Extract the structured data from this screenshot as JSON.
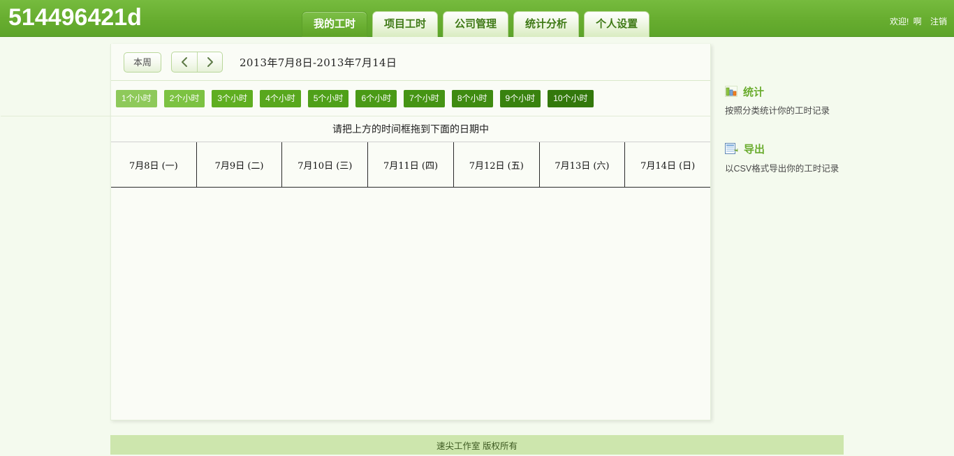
{
  "header": {
    "brand": "514496421d",
    "tabs": [
      {
        "label": "我的工时",
        "active": true
      },
      {
        "label": "项目工时",
        "active": false
      },
      {
        "label": "公司管理",
        "active": false
      },
      {
        "label": "统计分析",
        "active": false
      },
      {
        "label": "个人设置",
        "active": false
      }
    ],
    "welcome": "欢迎!",
    "user_name": "啊",
    "logout": "注销",
    "bg_color": "#67ad2f"
  },
  "toolbar": {
    "this_week_label": "本周",
    "prev_icon": "chevron-left-icon",
    "next_icon": "chevron-right-icon",
    "date_range": "2013年7月8日-2013年7月14日"
  },
  "chips": [
    {
      "label": "1个小时",
      "color": "#8ec95a"
    },
    {
      "label": "2个小时",
      "color": "#7cc242"
    },
    {
      "label": "3个小时",
      "color": "#5fae21"
    },
    {
      "label": "4个小时",
      "color": "#58a71d"
    },
    {
      "label": "5个小时",
      "color": "#4fa019"
    },
    {
      "label": "6个小时",
      "color": "#4a9a16"
    },
    {
      "label": "7个小时",
      "color": "#459414"
    },
    {
      "label": "8个小时",
      "color": "#3f8b11"
    },
    {
      "label": "9个小时",
      "color": "#39820f"
    },
    {
      "label": "10个小时",
      "color": "#33780c"
    }
  ],
  "hint": "请把上方的时间框拖到下面的日期中",
  "days": [
    "7月8日 (一)",
    "7月9日 (二)",
    "7月10日 (三)",
    "7月11日 (四)",
    "7月12日 (五)",
    "7月13日 (六)",
    "7月14日 (日)"
  ],
  "sidebar": {
    "blocks": [
      {
        "icon": "bar-chart-icon",
        "title": "统计",
        "desc": "按照分类统计你的工时记录"
      },
      {
        "icon": "export-csv-icon",
        "title": "导出",
        "desc": "以CSV格式导出你的工时记录"
      }
    ]
  },
  "footer": {
    "text": "速尖工作室 版权所有",
    "bg_color": "#cde6ad"
  }
}
